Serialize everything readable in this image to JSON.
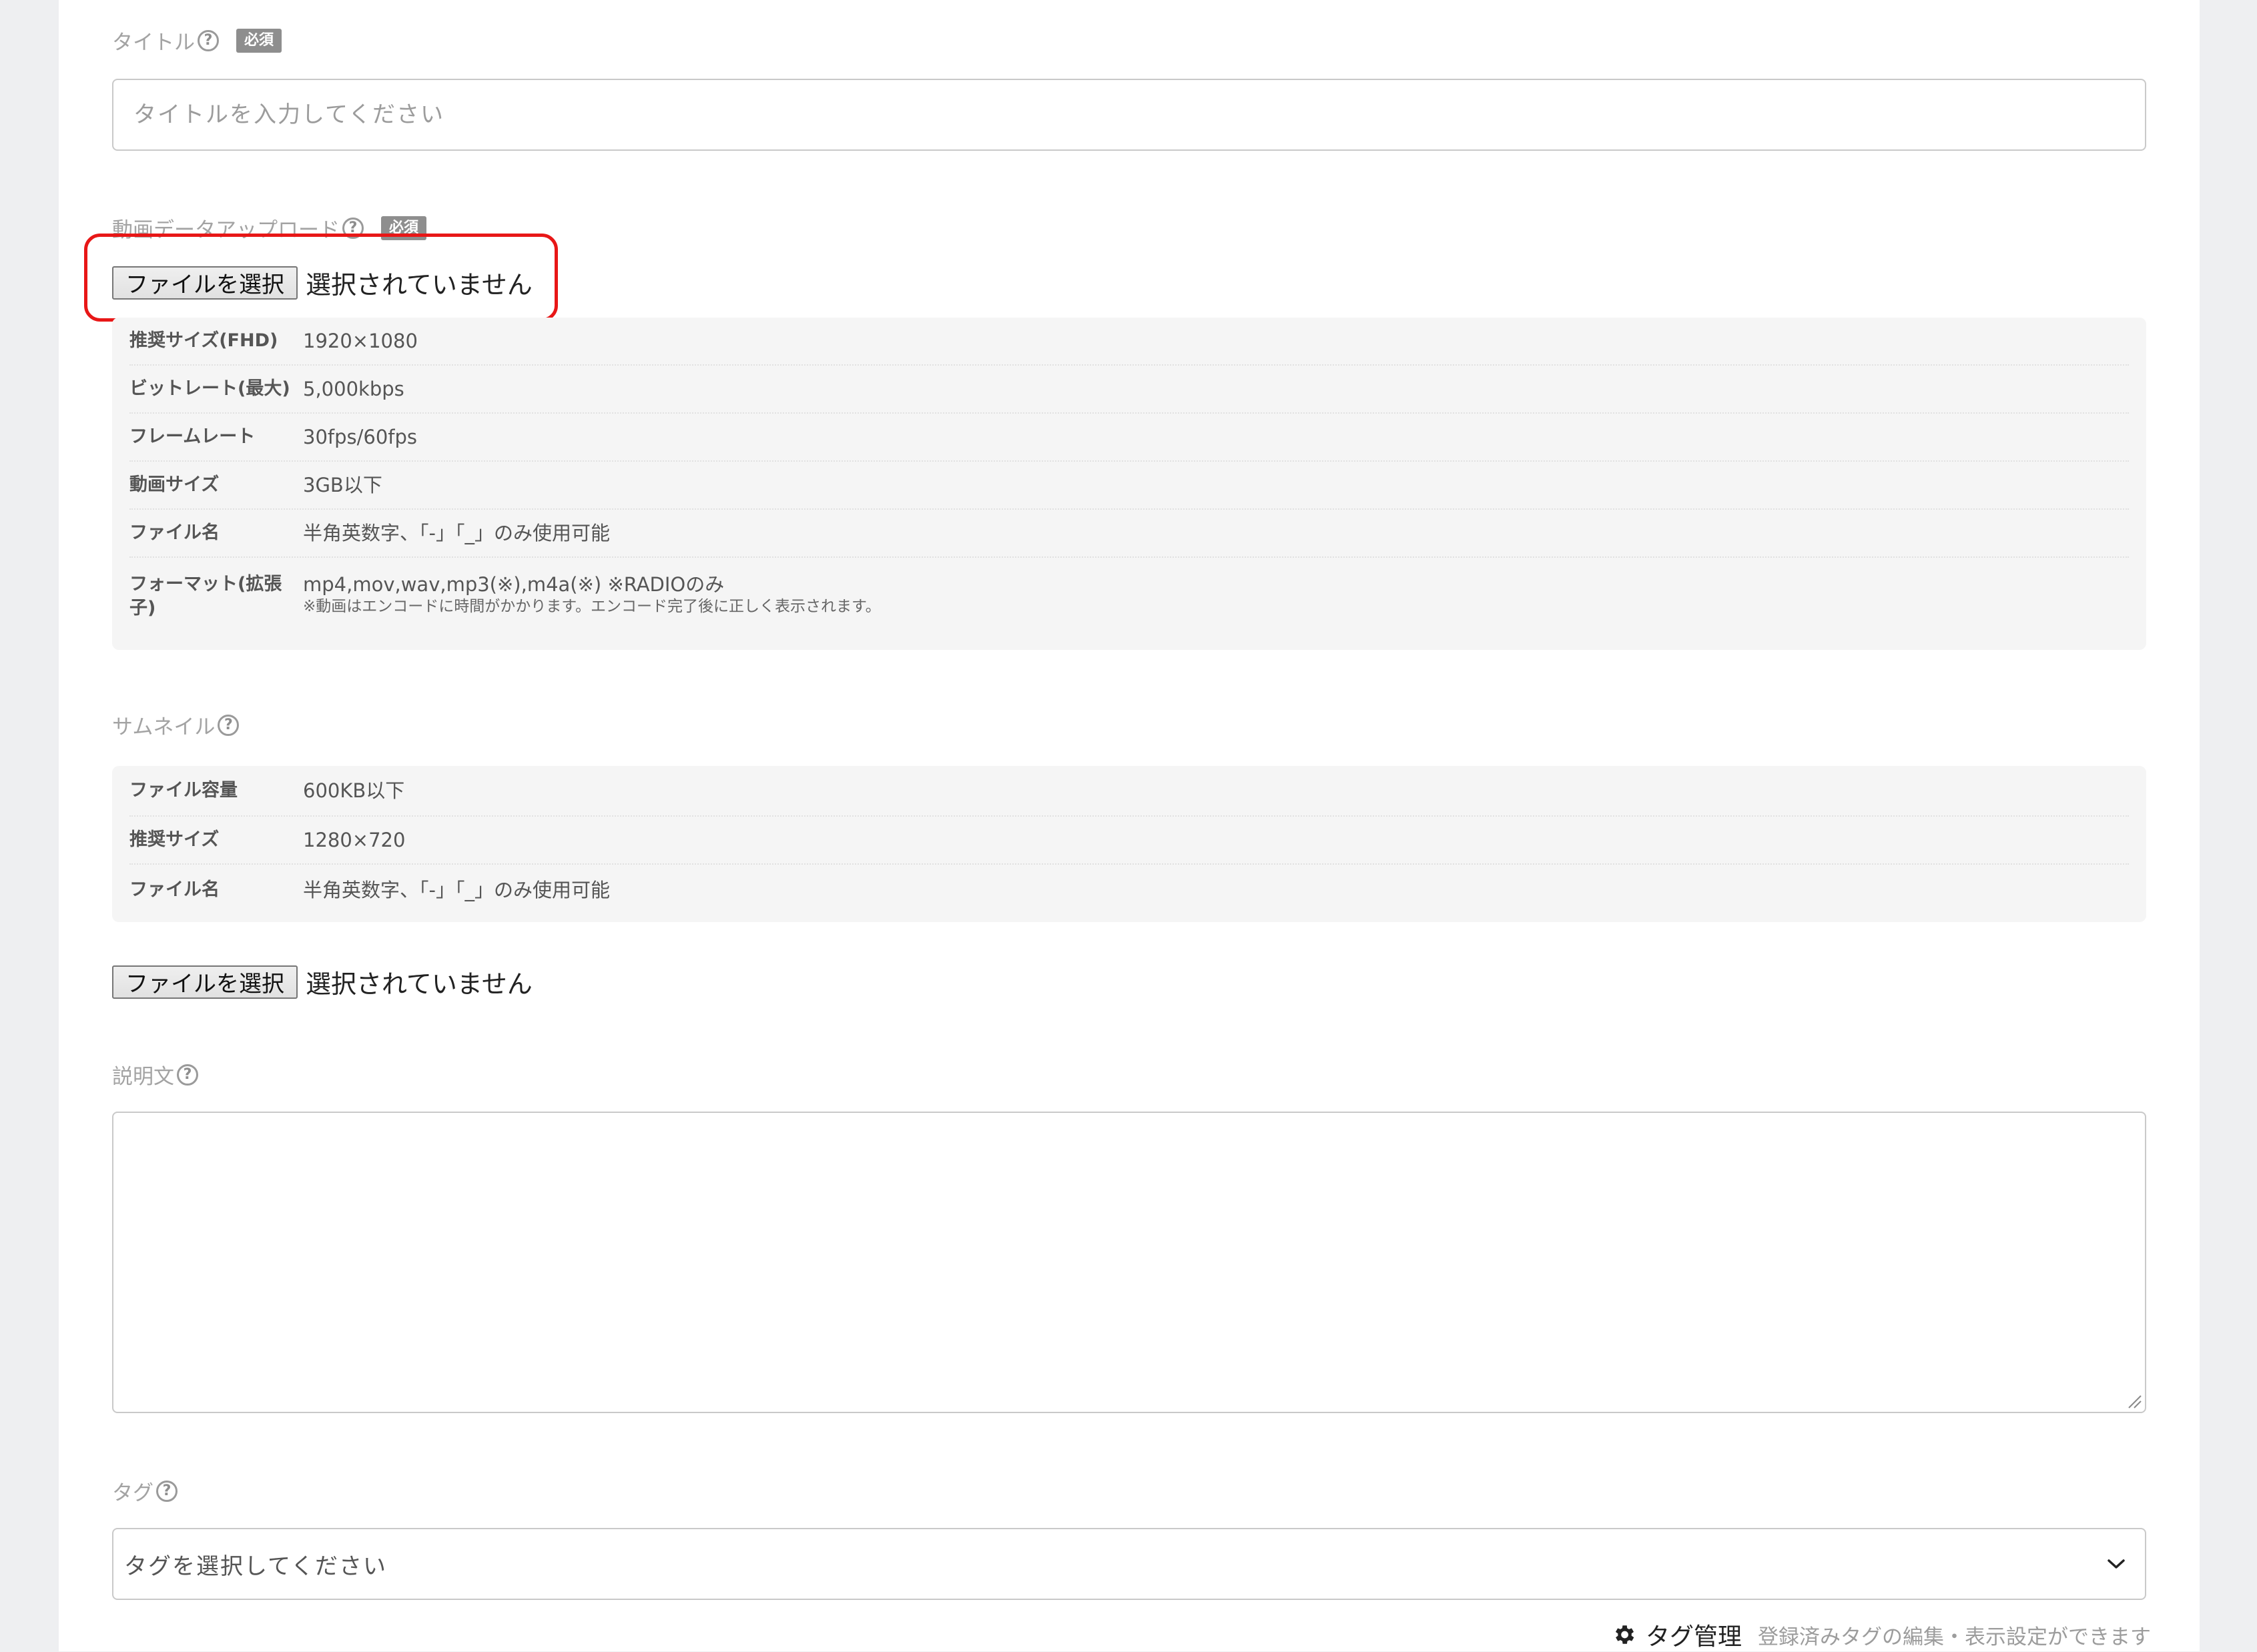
{
  "title_field": {
    "label": "タイトル",
    "required_badge": "必須",
    "placeholder": "タイトルを入力してください"
  },
  "video_upload": {
    "label": "動画データアップロード",
    "required_badge": "必須",
    "button_label": "ファイルを選択",
    "status": "選択されていません",
    "specs": [
      {
        "key": "推奨サイズ(FHD)",
        "value": "1920×1080"
      },
      {
        "key": "ビットレート(最大)",
        "value": "5,000kbps"
      },
      {
        "key": "フレームレート",
        "value": "30fps/60fps"
      },
      {
        "key": "動画サイズ",
        "value": "3GB以下"
      },
      {
        "key": "ファイル名",
        "value": "半角英数字、「-」「_」のみ使用可能"
      },
      {
        "key": "フォーマット(拡張子)",
        "value": "mp4,mov,wav,mp3(※),m4a(※) ※RADIOのみ",
        "note": "※動画はエンコードに時間がかかります。エンコード完了後に正しく表示されます。"
      }
    ]
  },
  "thumbnail": {
    "label": "サムネイル",
    "specs": [
      {
        "key": "ファイル容量",
        "value": "600KB以下"
      },
      {
        "key": "推奨サイズ",
        "value": "1280×720"
      },
      {
        "key": "ファイル名",
        "value": "半角英数字、「-」「_」のみ使用可能"
      }
    ],
    "button_label": "ファイルを選択",
    "status": "選択されていません"
  },
  "description": {
    "label": "説明文",
    "value": ""
  },
  "tags": {
    "label": "タグ",
    "placeholder": "タグを選択してください",
    "manage_link": "タグ管理",
    "manage_hint": "登録済みタグの編集・表示設定ができます"
  },
  "colors": {
    "highlight": "#e81717",
    "background": "#eeeff1",
    "card": "#ffffff",
    "spec_bg": "#f5f5f5",
    "badge": "#8e8e8e"
  },
  "icons": {
    "help": "question-circle-icon",
    "select_arrow": "chevron-down-icon",
    "manage": "gear-icon",
    "resize": "resize-grip-icon"
  }
}
